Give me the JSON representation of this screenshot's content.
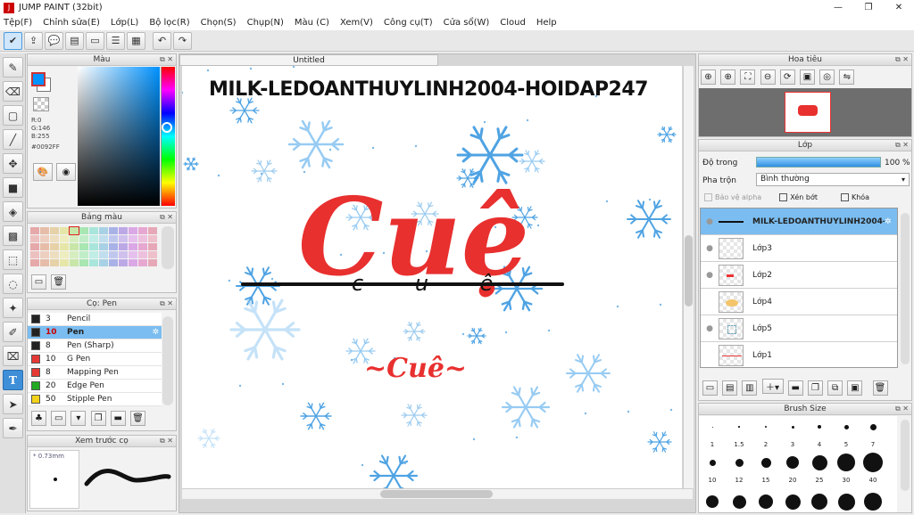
{
  "app": {
    "title": "JUMP PAINT (32bit)"
  },
  "menu": [
    "Tệp(F)",
    "Chỉnh sửa(E)",
    "Lớp(L)",
    "Bộ lọc(R)",
    "Chọn(S)",
    "Chụp(N)",
    "Màu (C)",
    "Xem(V)",
    "Công cụ(T)",
    "Cửa sổ(W)",
    "Cloud",
    "Help"
  ],
  "color_panel": {
    "title": "Màu",
    "r": "R:0",
    "g": "G:146",
    "b": "B:255",
    "hex": "#0092FF",
    "fg": "#0092ff",
    "bg": "#ffffff"
  },
  "palette_panel": {
    "title": "Bảng màu"
  },
  "brush_panel": {
    "title": "Cọ: Pen",
    "items": [
      {
        "size": "3",
        "name": "Pencil",
        "color": "#222222"
      },
      {
        "size": "10",
        "name": "Pen",
        "color": "#222222"
      },
      {
        "size": "8",
        "name": "Pen (Sharp)",
        "color": "#222222"
      },
      {
        "size": "10",
        "name": "G Pen",
        "color": "#e53935"
      },
      {
        "size": "8",
        "name": "Mapping Pen",
        "color": "#e53935"
      },
      {
        "size": "20",
        "name": "Edge Pen",
        "color": "#22aa22"
      },
      {
        "size": "50",
        "name": "Stipple Pen",
        "color": "#f2d21b"
      }
    ]
  },
  "preview_panel": {
    "title": "Xem trước cọ",
    "size": "0.73mm"
  },
  "canvas": {
    "tab": "Untitled",
    "heading": "MILK-LEDOANTHUYLINH2004-HOIDAP247",
    "script_word": "Cuệ",
    "midline": "c u ê",
    "subtitle": "~Cuê~"
  },
  "navigator": {
    "title": "Hoa tiêu"
  },
  "layer_panel": {
    "title": "Lớp",
    "opacity_label": "Độ trong",
    "opacity_value": "100 %",
    "opacity_fraction": 1.0,
    "blend_label": "Pha trộn",
    "blend_value": "Bình thường",
    "protect_alpha": "Bảo vệ alpha",
    "clip": "Xén bớt",
    "lock": "Khóa",
    "layers": [
      "MILK-LEDOANTHUYLINH2004-H",
      "Lớp3",
      "Lớp2",
      "Lớp4",
      "Lớp5",
      "Lớp1"
    ]
  },
  "brushsize_panel": {
    "title": "Brush Size",
    "row1": [
      "1",
      "1.5",
      "2",
      "3",
      "4",
      "5",
      "7"
    ],
    "row2": [
      "10",
      "12",
      "15",
      "20",
      "25",
      "30",
      "40"
    ]
  },
  "colors": {
    "accent": "#3e8fd8",
    "selection": "#7bbdf0",
    "red": "#e8302f",
    "snow": "#3d9ae0"
  }
}
